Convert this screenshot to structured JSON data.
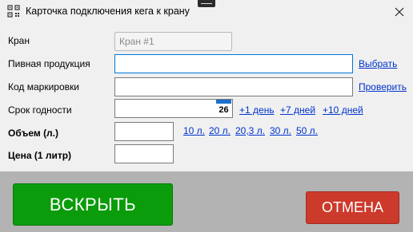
{
  "window": {
    "title": "Карточка подключения кега к крану",
    "close_symbol": "✕"
  },
  "form": {
    "tap": {
      "label": "Кран",
      "value": "Кран #1"
    },
    "beer": {
      "label": "Пивная продукция",
      "value": "",
      "link": "Выбрать"
    },
    "marking": {
      "label": "Код маркировки",
      "value": "",
      "link": "Проверить"
    },
    "expiry": {
      "label": "Срок годности",
      "value": "",
      "calendar_day": "26",
      "quick_links": [
        "+1 день",
        "+7 дней",
        "+10 дней"
      ]
    },
    "volume": {
      "label": "Объем (л.)",
      "value": "",
      "quick_links": [
        "10 л.",
        "20 л.",
        "20,3 л.",
        "30 л.",
        "50 л."
      ]
    },
    "price": {
      "label": "Цена (1 литр)",
      "value": ""
    }
  },
  "actions": {
    "open_label": "ВСКРЫТЬ",
    "cancel_label": "ОТМЕНА"
  },
  "colors": {
    "open_button": "#0b9c0b",
    "cancel_button": "#cc3a2c",
    "link": "#0033cc",
    "calendar_accent": "#1d6fd0"
  },
  "icons": {
    "app": "app-grid-icon",
    "close": "close-icon",
    "calendar": "calendar-icon"
  }
}
